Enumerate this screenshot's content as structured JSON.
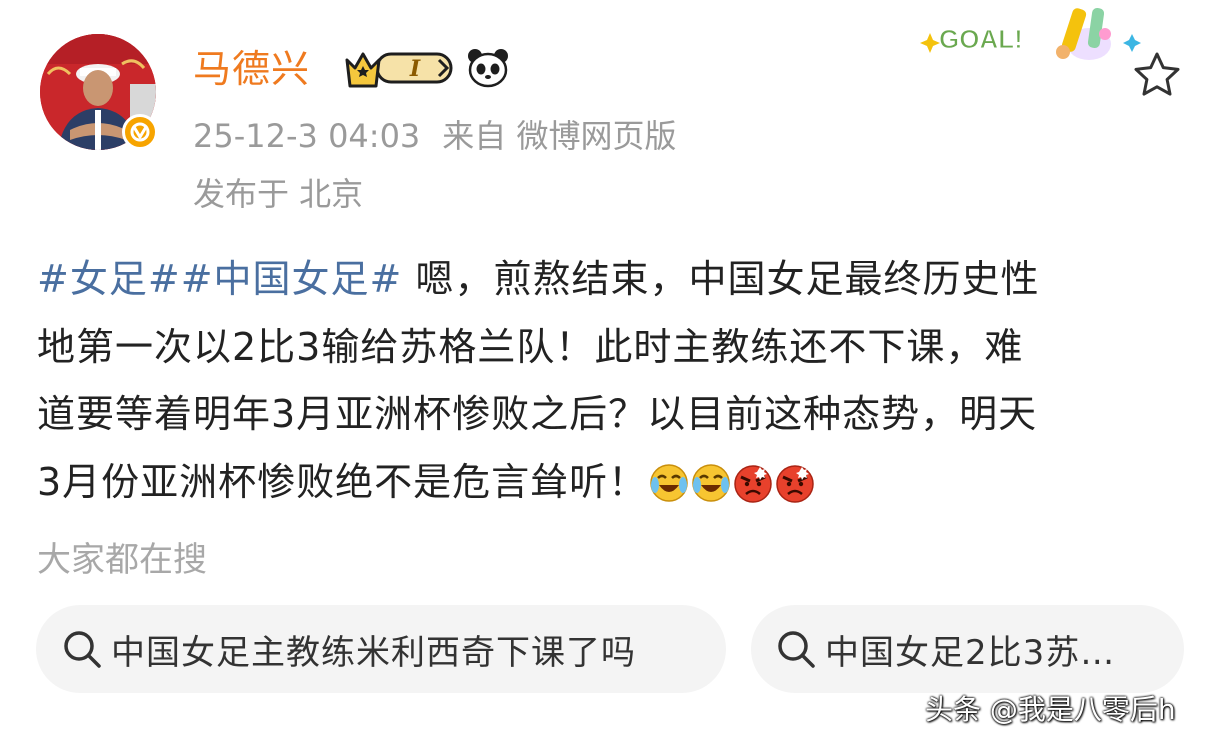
{
  "header": {
    "username": "马德兴",
    "level_badge_label": "I",
    "timestamp": "25-12-3 04:03",
    "source": "来自 微博网页版",
    "location": "发布于 北京",
    "goal_badge_text": "GOAL!"
  },
  "post": {
    "hashtag_1": "#女足#",
    "hashtag_2": "#中国女足#",
    "line_1": " 嗯，煎熬结束，中国女足最终历史性",
    "line_2": "地第一次以2比3输给苏格兰队！此时主教练还不下课，难",
    "line_3": "道要等着明年3月亚洲杯惨败之后？以目前这种态势，明天",
    "line_4": "3月份亚洲杯惨败绝不是危言耸听！",
    "emojis": [
      "laughing-crying-emoji",
      "laughing-crying-emoji",
      "angry-emoji",
      "angry-emoji"
    ]
  },
  "search": {
    "heading": "大家都在搜",
    "chip_1": "中国女足主教练米利西奇下课了吗",
    "chip_2": "中国女足2比3苏…"
  },
  "watermark": "头条 @我是八零后h",
  "colors": {
    "username": "#ef7a1f",
    "hashtag": "#4a6fa0",
    "meta": "#9a9a9a",
    "chip_bg": "#f4f4f4",
    "verified": "#f7a400"
  }
}
